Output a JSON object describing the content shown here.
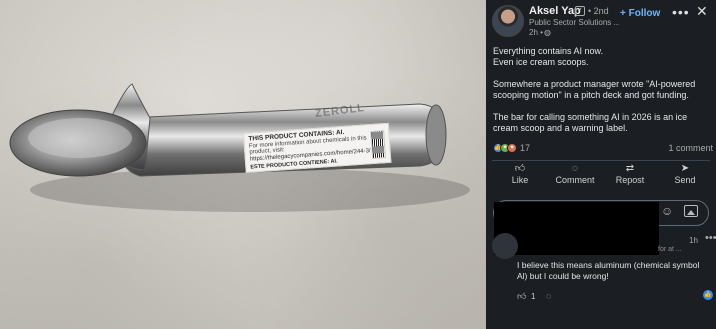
{
  "photo": {
    "sticker_heading": "THIS PRODUCT CONTAINS: AI.",
    "sticker_body": "For more information about chemicals in this product, visit:",
    "sticker_url": "https://thelegacycompanies.com/home/244-3/",
    "sticker_spanish": "ESTE PRODUCTO CONTIENE: AI.",
    "engraving": "ZEROLL"
  },
  "post": {
    "author": "Aksel Yap",
    "degree": "• 2nd",
    "subtitle": "Public Sector Solutions ...",
    "time": "2h •",
    "follow_label": "+ Follow",
    "more_label": "•••",
    "close_label": "✕",
    "paragraphs": [
      "Everything contains AI now.\nEven ice cream scoops.",
      "Somewhere a product manager wrote \"AI-powered scooping motion\" in a pitch deck and got funding.",
      "The bar for calling something AI in 2026 is an ice cream scoop and a warning label."
    ],
    "reaction_count": "17",
    "comment_count": "1 comment",
    "actions": {
      "like": "Like",
      "comment": "Comment",
      "repost": "Repost",
      "send": "Send"
    }
  },
  "comment": {
    "time": "1h",
    "more_label": "•••",
    "meta": "for at ...",
    "text": "I believe this means aluminum (chemical symbol Al) but I could be wrong!",
    "like_count": "1"
  },
  "colors": {
    "background": "#1b1f23",
    "accent": "#70b5f9",
    "reaction_like": "#378fe9",
    "reaction_celebrate": "#6dae4f",
    "reaction_love": "#df704d"
  },
  "icons": {
    "verify": "verified-badge-icon",
    "globe": "globe-icon",
    "like": "thumbs-up-icon",
    "comment": "speech-bubble-icon",
    "repost": "repost-arrows-icon",
    "send": "paper-plane-icon",
    "emoji": "smiley-icon",
    "image": "image-icon"
  }
}
